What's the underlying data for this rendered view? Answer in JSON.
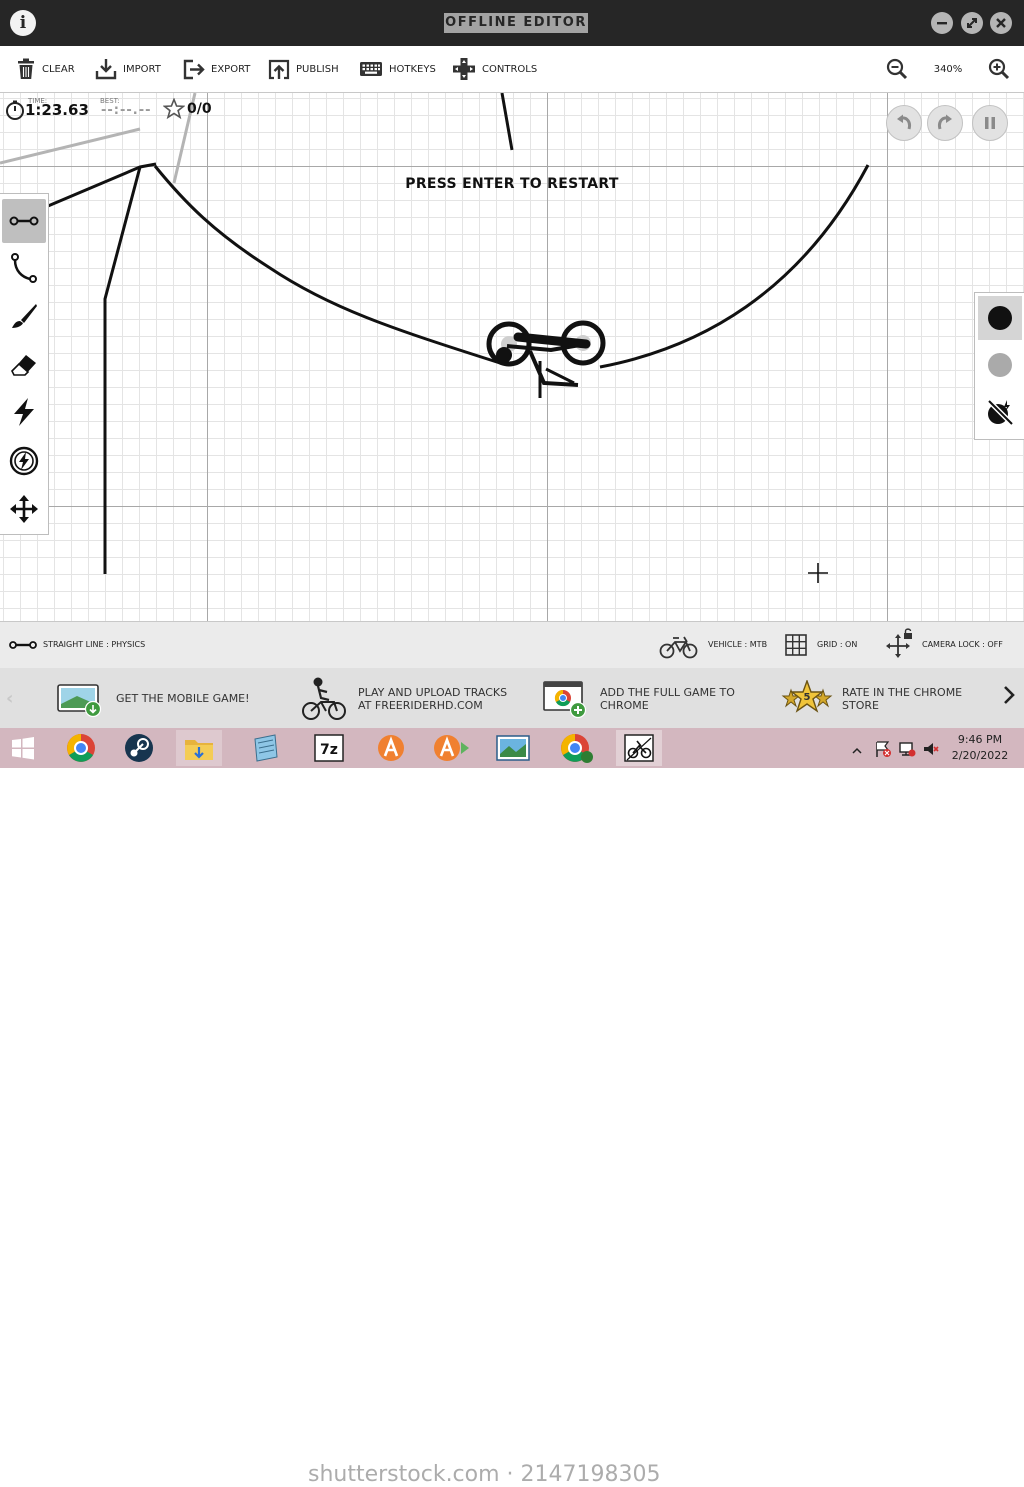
{
  "window": {
    "title": "OFFLINE EDITOR",
    "info_icon": "i",
    "controls": [
      "minimize-icon",
      "maximize-icon",
      "close-icon"
    ]
  },
  "toolbar": {
    "clear": "CLEAR",
    "import": "IMPORT",
    "export": "EXPORT",
    "publish": "PUBLISH",
    "hotkeys": "HOTKEYS",
    "controls": "CONTROLS",
    "zoom": "340%"
  },
  "hud": {
    "time_label": "TIME:",
    "time": "1:23.63",
    "best_label": "BEST:",
    "best": "--:--.--",
    "stars": "0/0"
  },
  "canvas": {
    "message": "PRESS ENTER TO RESTART"
  },
  "tools": {
    "items": [
      "straight-line-icon",
      "curve-icon",
      "brush-icon",
      "eraser-icon",
      "boost-icon",
      "gravity-icon",
      "move-icon"
    ],
    "active": "straight-line-icon"
  },
  "line_colors": {
    "items": [
      "physics",
      "scenery",
      "powerups"
    ],
    "physics_color": "#111111",
    "scenery_color": "#aaaaaa",
    "active": "physics"
  },
  "status": {
    "tool": "STRAIGHT LINE : PHYSICS",
    "vehicle": "VEHICLE : MTB",
    "grid": "GRID : ON",
    "camera": "CAMERA LOCK : OFF"
  },
  "promos": [
    {
      "line1": "GET THE MOBILE GAME!",
      "line2": ""
    },
    {
      "line1": "PLAY AND UPLOAD TRACKS",
      "line2": "AT FREERIDERHD.COM"
    },
    {
      "line1": "ADD THE FULL GAME TO",
      "line2": "CHROME"
    },
    {
      "line1": "RATE IN THE CHROME",
      "line2": "STORE"
    }
  ],
  "rating_badge": "5",
  "taskbar": {
    "watermark": "shutterstock.com · 2147198305",
    "time": "9:46 PM",
    "date": "2/20/2022"
  },
  "colors": {
    "titlebar": "#262626",
    "canvas_bg": "#ffffff",
    "grid_major": "#a8a8a8",
    "grid_minor": "#e4e4e4",
    "taskbar": "#d3b7bf"
  }
}
